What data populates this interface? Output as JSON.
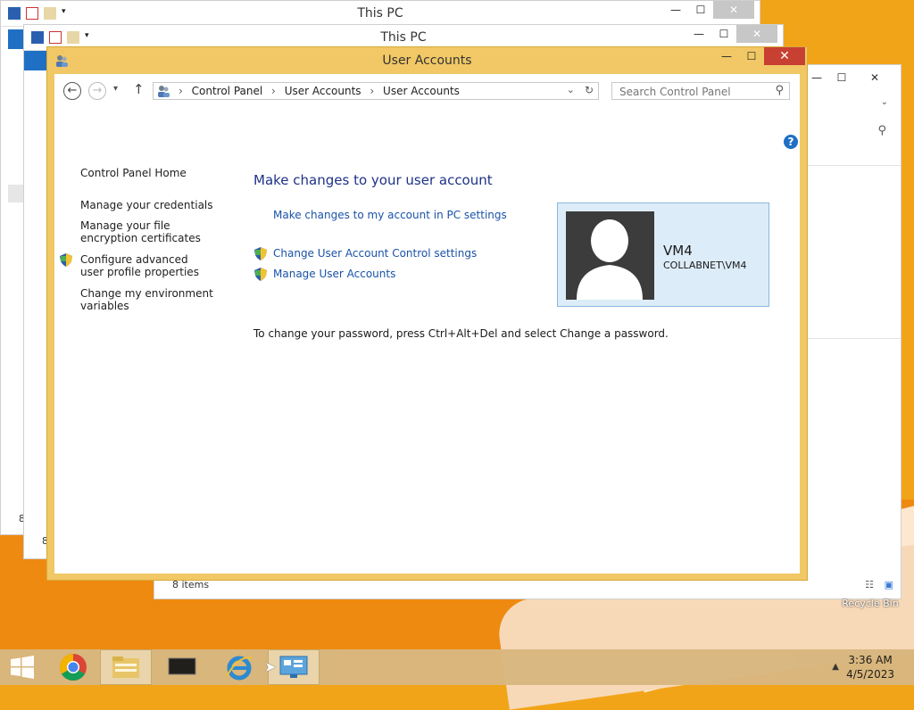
{
  "desktop": {
    "recycle_bin_label": "Recycle Bin"
  },
  "bg_windows": {
    "this_pc_title_1": "This PC",
    "this_pc_title_2": "This PC",
    "status_items": "8 items",
    "fragment_1": "8",
    "fragment_2": "8"
  },
  "window": {
    "title": "User Accounts",
    "minimize": "—",
    "maximize": "☐",
    "close": "✕"
  },
  "nav": {
    "breadcrumbs": [
      "Control Panel",
      "User Accounts",
      "User Accounts"
    ],
    "search_placeholder": "Search Control Panel"
  },
  "left_pane": {
    "home": "Control Panel Home",
    "credentials": "Manage your credentials",
    "encryption": "Manage your file encryption certificates",
    "advanced_profile": "Configure advanced user profile properties",
    "env_vars": "Change my environment variables"
  },
  "main": {
    "heading": "Make changes to your user account",
    "pc_settings_link": "Make changes to my account in PC settings",
    "uac_link": "Change User Account Control settings",
    "manage_link": "Manage User Accounts",
    "password_note": "To change your password, press Ctrl+Alt+Del and select Change a password."
  },
  "user": {
    "name": "VM4",
    "domain_account": "COLLABNET\\VM4"
  },
  "taskbar": {
    "time": "3:36 AM",
    "date": "4/5/2023"
  },
  "colors": {
    "window_frame": "#f1c865",
    "close_red": "#c84031",
    "link_blue": "#1a52a8",
    "heading_blue": "#1e3287",
    "card_bg": "#dcecf8"
  }
}
